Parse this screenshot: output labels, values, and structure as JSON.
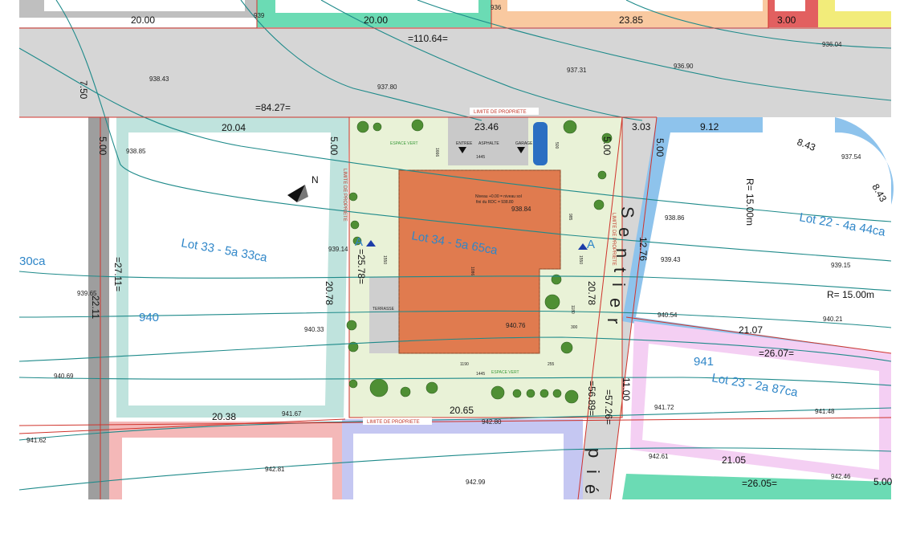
{
  "lots": {
    "lot30": "30ca",
    "lot33": "Lot 33 - 5a 33ca",
    "lot34": "Lot 34 - 5a 65ca",
    "lot22": "Lot 22 - 4a 44ca",
    "lot23": "Lot 23 - 2a 87ca"
  },
  "road_label": {
    "sentier": [
      "S",
      "e",
      "n",
      "t",
      "i",
      "e",
      "r"
    ],
    "pie": [
      "p",
      "i",
      "é"
    ]
  },
  "top_dims": {
    "d1": "20.00",
    "d2": "20.00",
    "d3": "23.85",
    "d4": "3.00",
    "road_total": "=110.64="
  },
  "dims": {
    "d_7_50": "7.50",
    "d_84_27": "=84.27=",
    "d_20_04": "20.04",
    "d_23_46": "23.46",
    "d_3_03": "3.03",
    "d_9_12": "9.12",
    "d_8_43a": "8.43",
    "d_8_43b": "8.43",
    "d_5_00a": "5.00",
    "d_5_00b": "5.00",
    "d_5_00c": "5.00",
    "d_5_00d": "5.00",
    "d_27_11": "=27.11=",
    "d_22_11": "22.11",
    "d_25_78": "=25.78=",
    "d_20_78a": "20.78",
    "d_20_78b": "20.78",
    "d_12_76": "12.76",
    "d_r1": "R= 15.00m",
    "d_r2": "R= 15.00m",
    "d_21_07": "21.07",
    "d_26_07": "=26.07=",
    "d_11_00": "11.00",
    "d_57_26": "=57.26=",
    "d_56_89": "=56.89=",
    "d_20_38": "20.38",
    "d_20_65": "20.65",
    "d_21_05": "21.05",
    "d_26_05": "=26.05=",
    "d_5_00e": "5.00"
  },
  "altitudes": [
    "938.43",
    "937.80",
    "937.31",
    "936.90",
    "936.04",
    "938.85",
    "938.84",
    "937.54",
    "938.86",
    "939.14",
    "939.43",
    "939.15",
    "939.65",
    "940.33",
    "940.76",
    "940.54",
    "940.21",
    "940.69",
    "941.67",
    "941.62",
    "941.72",
    "941.48",
    "942.80",
    "942.81",
    "942.99",
    "942.61",
    "942.46",
    "939",
    "936"
  ],
  "contour_label": "940",
  "contour_label_941": "941",
  "plan_labels": {
    "limit_top": "LIMITE DE PROPRIETE",
    "limit_bottom": "LIMITE DE PROPRIETE",
    "limit_left": "LIMITE DE PROPRIETE",
    "limit_right": "LIMITE DE PROPRIETE",
    "espace_vert_top": "ESPACE VERT",
    "espace_vert_bottom": "ESPACE VERT",
    "entree": "ENTREE",
    "asphalte": "ASPHALTE",
    "garage": "GARAGE",
    "terrasse": "TERRASSE",
    "niveau1": "Niveau +0.00 = niveau sol",
    "niveau2": "fini du RDC = 938.80",
    "section_a": "A",
    "north": "N",
    "m1445a": "1445",
    "m1445b": "1445",
    "m1190": "1190",
    "m1550a": "1550",
    "m1550b": "1550",
    "m1666": "1666",
    "m985": "985",
    "m300": "300",
    "m255": "255",
    "m1180": "1180",
    "m500": "500",
    "m1086": "1086"
  },
  "colors": {
    "road": "#d6d6d6",
    "lot33_band": "#bfe3dd",
    "lot22_band": "#8ec3ec",
    "lot23_band": "#f4cff3",
    "green_top": "#6bdbb4",
    "orange_top": "#f9c9a0",
    "yellow_top": "#f2ec7a",
    "red_top": "#e26060",
    "site": "#e9f2d7",
    "house": "#e07b4f",
    "contour": "#1e8a8a",
    "lot_text": "#2f86c8"
  }
}
